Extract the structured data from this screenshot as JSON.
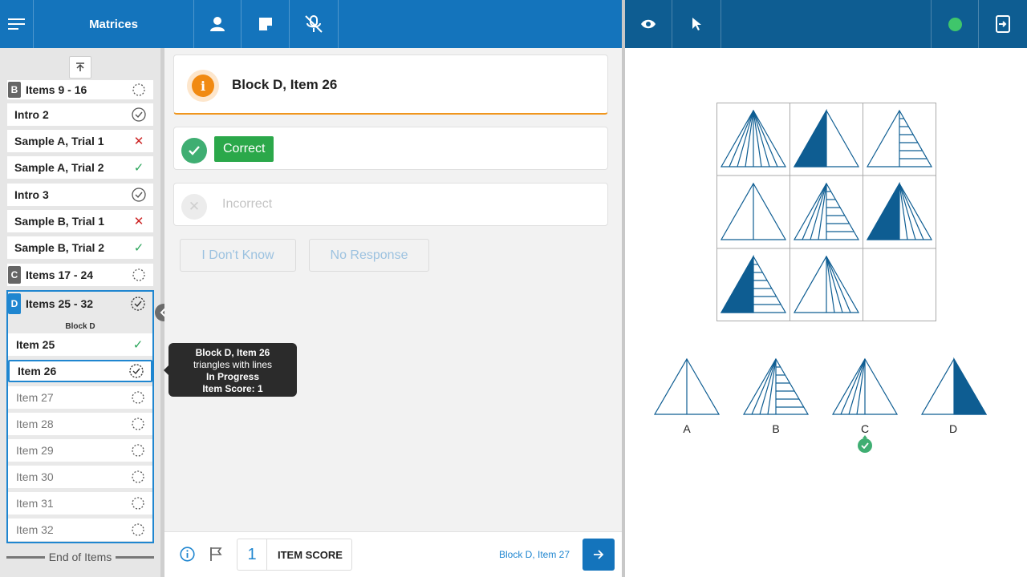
{
  "header": {
    "title": "Matrices",
    "status_color": "#3fc66b"
  },
  "sidebar": {
    "rows": [
      {
        "block": "B",
        "label": "Items 9 - 16",
        "status": "in-progress"
      },
      {
        "label": "Intro 2",
        "status": "complete"
      },
      {
        "label": "Sample A, Trial 1",
        "status": "incorrect"
      },
      {
        "label": "Sample A, Trial 2",
        "status": "correct"
      },
      {
        "label": "Intro 3",
        "status": "complete"
      },
      {
        "label": "Sample B, Trial 1",
        "status": "incorrect"
      },
      {
        "label": "Sample B, Trial 2",
        "status": "correct"
      },
      {
        "block": "C",
        "label": "Items 17 - 24",
        "status": "not-started"
      }
    ],
    "block_d": {
      "letter": "D",
      "label": "Items 25 - 32",
      "subtitle": "Block D",
      "items": [
        {
          "label": "Item 25",
          "status": "correct"
        },
        {
          "label": "Item 26",
          "status": "in-progress"
        },
        {
          "label": "Item 27",
          "status": "not-started"
        },
        {
          "label": "Item 28",
          "status": "not-started"
        },
        {
          "label": "Item 29",
          "status": "not-started"
        },
        {
          "label": "Item 30",
          "status": "not-started"
        },
        {
          "label": "Item 31",
          "status": "not-started"
        },
        {
          "label": "Item 32",
          "status": "not-started"
        }
      ]
    },
    "end_label": "End of Items"
  },
  "tooltip": {
    "title": "Block D, Item 26",
    "description": "triangles with lines",
    "status": "In Progress",
    "score": "Item Score: 1"
  },
  "main": {
    "item_title": "Block D, Item 26",
    "correct_label": "Correct",
    "incorrect_label": "Incorrect",
    "dont_know_label": "I Don't Know",
    "no_response_label": "No Response"
  },
  "footer": {
    "score_value": "1",
    "score_label": "ITEM SCORE",
    "next_item_label": "Block D, Item 27"
  },
  "stimulus": {
    "options": [
      "A",
      "B",
      "C",
      "D"
    ],
    "selected_option": "C"
  },
  "colors": {
    "primary": "#1474bc",
    "header_right": "#0e5d92",
    "correct": "#2ba84a",
    "incorrect": "#cc2222",
    "info": "#f18a12",
    "figure": "#0e5d92"
  }
}
